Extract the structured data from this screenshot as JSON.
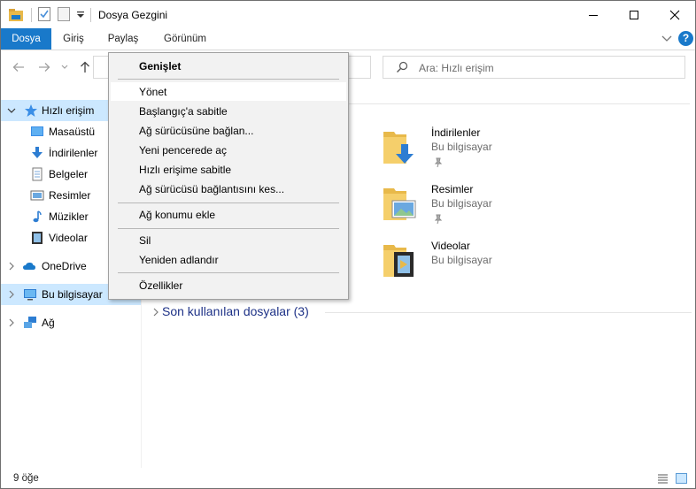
{
  "window": {
    "title": "Dosya Gezgini"
  },
  "ribbon": {
    "tabs": [
      "Dosya",
      "Giriş",
      "Paylaş",
      "Görünüm"
    ],
    "help": "?"
  },
  "search": {
    "placeholder": "Ara: Hızlı erişim"
  },
  "sidebar": {
    "quick_access": "Hızlı erişim",
    "items": [
      "Masaüstü",
      "İndirilenler",
      "Belgeler",
      "Resimler",
      "Müzikler",
      "Videolar"
    ],
    "onedrive": "OneDrive",
    "this_pc": "Bu bilgisayar",
    "network": "Ağ"
  },
  "content": {
    "folders": [
      {
        "name": "İndirilenler",
        "location": "Bu bilgisayar"
      },
      {
        "name": "Resimler",
        "location": "Bu bilgisayar"
      },
      {
        "name": "Videolar",
        "location": "Bu bilgisayar"
      }
    ],
    "recent_group": "Son kullanılan dosyalar (3)"
  },
  "status": {
    "count": "9 öğe"
  },
  "context_menu": {
    "items": [
      "Genişlet",
      "Yönet",
      "Başlangıç'a sabitle",
      "Ağ sürücüsüne bağlan...",
      "Yeni pencerede aç",
      "Hızlı erişime sabitle",
      "Ağ sürücüsü bağlantısını kes...",
      "Ağ konumu ekle",
      "Sil",
      "Yeniden adlandır",
      "Özellikler"
    ]
  },
  "colors": {
    "accent": "#1979ca",
    "selection": "#cce8ff",
    "folder": "#e8b94a",
    "link_blue": "#1e3287",
    "menu_bg": "#f2f2f2"
  }
}
